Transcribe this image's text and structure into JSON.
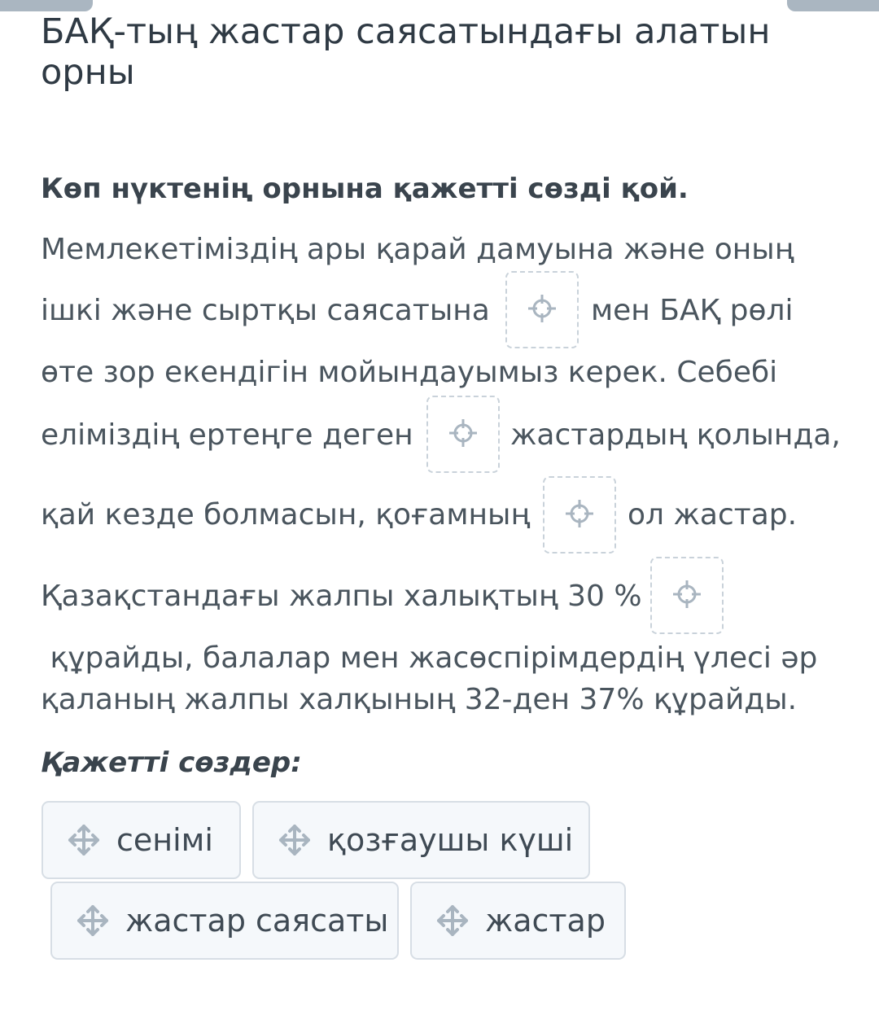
{
  "title": "БАҚ-тың жастар саясатындағы алатын орны",
  "instruction": "Көп нүктенің орнына қажетті сөзді қой.",
  "text_lines": [
    "Мемлекетіміздің ары қарай дамуына және оның",
    "ішкі және сыртқы саясатына",
    "мен БАҚ рөлі",
    "өте зор екендігін мойындауымыз керек. Себебі",
    "еліміздің ертеңге деген",
    "жастардың қолында,",
    "қай кезде болмасын, қоғамның",
    "ол жастар.",
    "Қазақстандағы жалпы халықтың 30 %",
    " құрайды, балалар мен жасөспірімдердің үлесі әр",
    "қаланың жалпы халқының 32-ден 37% құрайды."
  ],
  "blanks_count": 4,
  "words_heading": "Қажетті сөздер:",
  "word_options": [
    "сенімі",
    "қозғаушы күші",
    "жастар саясаты",
    "жастар"
  ],
  "icons": {
    "blank": "crosshair-icon",
    "option": "move-arrows-icon"
  },
  "colors": {
    "top_tab": "#aab6c1",
    "blank_border": "#c9d2da",
    "chip_background": "#f5f8fb",
    "chip_border": "#d7dee5",
    "icon": "#a9b5c0"
  }
}
